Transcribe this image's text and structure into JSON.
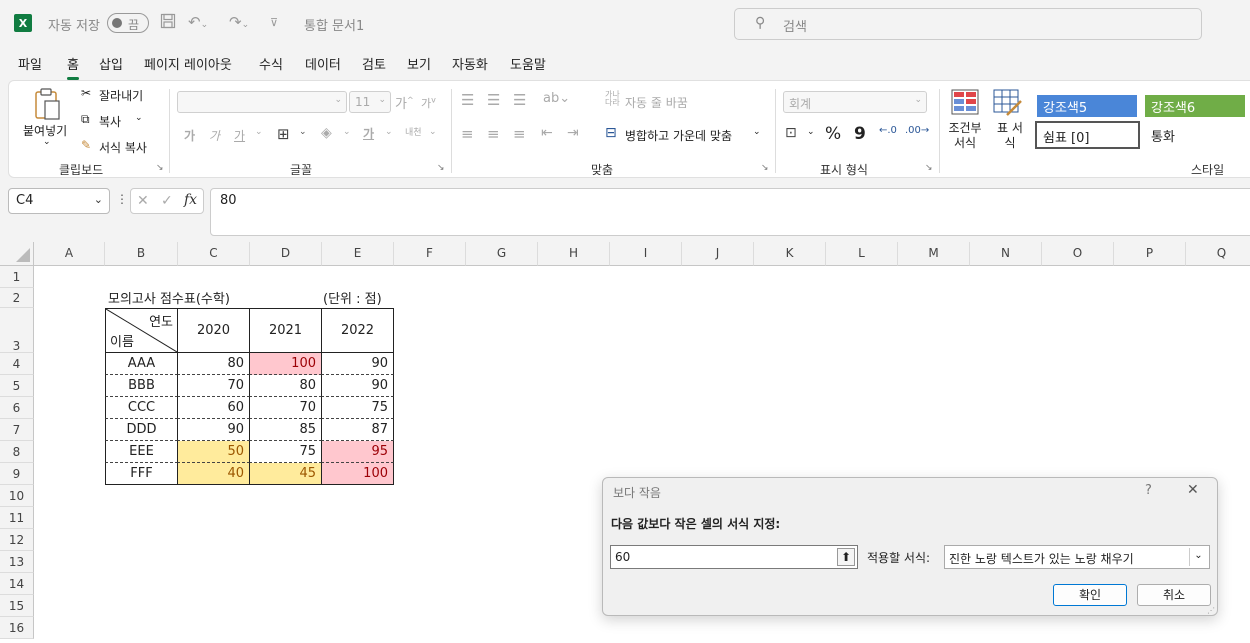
{
  "titlebar": {
    "logo": "X",
    "autosave_label": "자동 저장",
    "autosave_state": "끔",
    "doc_title": "통합 문서1",
    "search_placeholder": "검색"
  },
  "menu": [
    "파일",
    "홈",
    "삽입",
    "페이지 레이아웃",
    "수식",
    "데이터",
    "검토",
    "보기",
    "자동화",
    "도움말"
  ],
  "ribbon": {
    "clipboard": {
      "paste": "붙여넣기",
      "cut": "잘라내기",
      "copy": "복사",
      "format_painter": "서식 복사",
      "label": "클립보드"
    },
    "font": {
      "font_size": "11",
      "label": "글꼴",
      "grow": "가",
      "shrink": "가",
      "bold": "가",
      "italic": "가",
      "underline": "가",
      "font_color": "가",
      "phonetic": "내천"
    },
    "align": {
      "wrap": "자동 줄 바꿈",
      "merge": "병합하고 가운데 맞춤",
      "label": "맞춤"
    },
    "number": {
      "format": "회계",
      "percent": "%",
      "comma": "9",
      "label": "표시 형식"
    },
    "styles": {
      "conditional": "조건부 서식",
      "table": "표 서식",
      "accent5": "강조색5",
      "accent6": "강조색6",
      "comma0": "쉼표 [0]",
      "currency": "통화",
      "label": "스타일"
    }
  },
  "formula_bar": {
    "name_box": "C4",
    "formula": "80",
    "fx": "fx"
  },
  "columns": [
    "A",
    "B",
    "C",
    "D",
    "E",
    "F",
    "G",
    "H",
    "I",
    "J",
    "K",
    "L",
    "M",
    "N",
    "O",
    "P",
    "Q"
  ],
  "rows": [
    "1",
    "2",
    "3",
    "4",
    "5",
    "6",
    "7",
    "8",
    "9",
    "10",
    "11",
    "12",
    "13",
    "14",
    "15",
    "16"
  ],
  "table": {
    "title": "모의고사 점수표(수학)",
    "unit": "(단위 : 점)",
    "header_top": "연도",
    "header_bottom": "이름",
    "years": [
      "2020",
      "2021",
      "2022"
    ],
    "names": [
      "AAA",
      "BBB",
      "CCC",
      "DDD",
      "EEE",
      "FFF"
    ],
    "scores": [
      [
        "80",
        "100",
        "90"
      ],
      [
        "70",
        "80",
        "90"
      ],
      [
        "60",
        "70",
        "75"
      ],
      [
        "90",
        "85",
        "87"
      ],
      [
        "50",
        "75",
        "95"
      ],
      [
        "40",
        "45",
        "100"
      ]
    ],
    "colors": {
      "yellow_fill": "#ffeb9c",
      "yellow_text": "#9c5700",
      "red_fill": "#ffc7ce",
      "red_text": "#9c0006"
    }
  },
  "dialog": {
    "title": "보다 작음",
    "help": "?",
    "close": "✕",
    "instruction": "다음 값보다 작은 셀의 서식 지정:",
    "value": "60",
    "apply_label": "적용할 서식:",
    "format_option": "진한 노랑 텍스트가 있는 노랑 채우기",
    "ok": "확인",
    "cancel": "취소"
  }
}
